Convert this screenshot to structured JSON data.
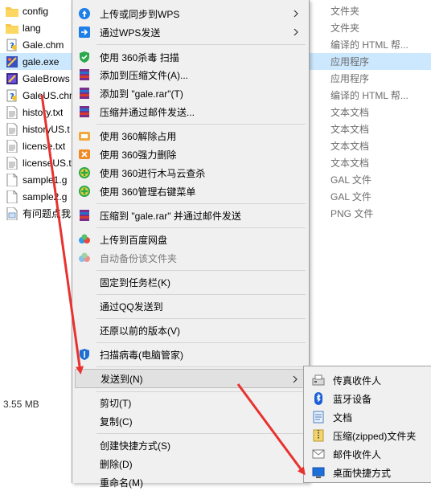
{
  "files": [
    {
      "name": "config",
      "icon": "folder-icon",
      "selected": false
    },
    {
      "name": "lang",
      "icon": "folder-icon",
      "selected": false
    },
    {
      "name": "Gale.chm",
      "icon": "help-file-icon",
      "selected": false
    },
    {
      "name": "gale.exe",
      "icon": "gale-exe-icon",
      "selected": true
    },
    {
      "name": "GaleBrows",
      "icon": "gale-browser-icon",
      "selected": false
    },
    {
      "name": "GaleUS.chm",
      "icon": "help-file-icon",
      "selected": false
    },
    {
      "name": "history.txt",
      "icon": "text-file-icon",
      "selected": false
    },
    {
      "name": "historyUS.t",
      "icon": "text-file-icon",
      "selected": false
    },
    {
      "name": "license.txt",
      "icon": "text-file-icon",
      "selected": false
    },
    {
      "name": "licenseUS.t",
      "icon": "text-file-icon",
      "selected": false
    },
    {
      "name": "sample1.g",
      "icon": "blank-file-icon",
      "selected": false
    },
    {
      "name": "sample2.g",
      "icon": "blank-file-icon",
      "selected": false
    },
    {
      "name": "有问题点我",
      "icon": "png-file-icon",
      "selected": false
    }
  ],
  "types": [
    {
      "label": "文件夹",
      "selected": false
    },
    {
      "label": "文件夹",
      "selected": false
    },
    {
      "label": "编译的 HTML 帮...",
      "selected": false
    },
    {
      "label": "应用程序",
      "selected": true
    },
    {
      "label": "应用程序",
      "selected": false
    },
    {
      "label": "编译的 HTML 帮...",
      "selected": false
    },
    {
      "label": "文本文档",
      "selected": false
    },
    {
      "label": "文本文档",
      "selected": false
    },
    {
      "label": "文本文档",
      "selected": false
    },
    {
      "label": "文本文档",
      "selected": false
    },
    {
      "label": "GAL 文件",
      "selected": false
    },
    {
      "label": "GAL 文件",
      "selected": false
    },
    {
      "label": "PNG 文件",
      "selected": false
    }
  ],
  "status": {
    "size": "3.55 MB"
  },
  "menu": {
    "upload_wps": "上传或同步到WPS",
    "send_wps": "通过WPS发送",
    "scan_360": "使用 360杀毒 扫描",
    "add_archive": "添加到压缩文件(A)...",
    "add_gale_rar": "添加到 \"gale.rar\"(T)",
    "compress_email": "压缩并通过邮件发送...",
    "unlock_360": "使用 360解除占用",
    "force_delete_360": "使用 360强力删除",
    "cloud_scan_360": "使用 360进行木马云查杀",
    "manage_menu_360": "使用 360管理右键菜单",
    "compress_rar_email": "压缩到 \"gale.rar\" 并通过邮件发送",
    "upload_baidu": "上传到百度网盘",
    "auto_backup": "自动备份该文件夹",
    "pin_taskbar": "固定到任务栏(K)",
    "send_qq": "通过QQ发送到",
    "restore_version": "还原以前的版本(V)",
    "scan_virus": "扫描病毒(电脑管家)",
    "send_to": "发送到(N)",
    "cut": "剪切(T)",
    "copy": "复制(C)",
    "create_shortcut": "创建快捷方式(S)",
    "delete": "删除(D)",
    "rename": "重命名(M)"
  },
  "submenu": {
    "fax": "传真收件人",
    "bluetooth": "蓝牙设备",
    "documents": "文档",
    "zip_folder": "压缩(zipped)文件夹",
    "mail": "邮件收件人",
    "desktop_shortcut": "桌面快捷方式"
  },
  "colors": {
    "selection": "#cce8ff",
    "menu_bg": "#f0f0f0",
    "annotation_arrow": "#e8322f"
  }
}
